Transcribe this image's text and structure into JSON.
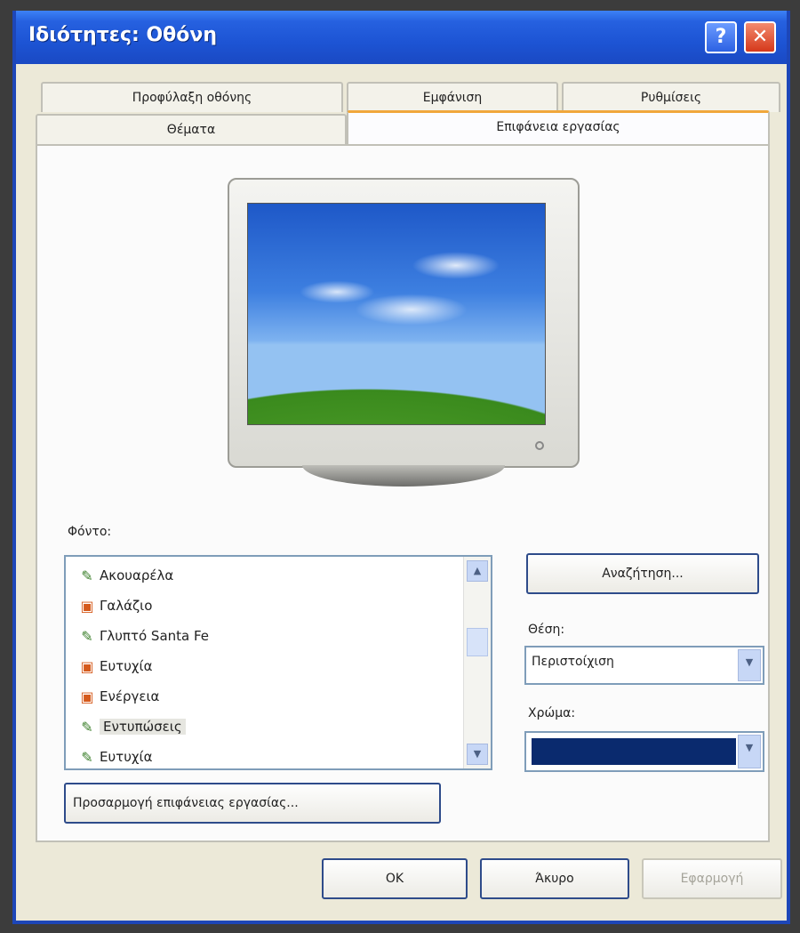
{
  "window": {
    "title": "Ιδιότητες: Οθόνη",
    "help_label": "?",
    "close_label": "✕"
  },
  "tabs": [
    {
      "label": "Προφύλαξη οθόνης"
    },
    {
      "label": "Εμφάνιση"
    },
    {
      "label": "Ρυθμίσεις"
    },
    {
      "label": "Θέματα"
    },
    {
      "label": "Επιφάνεια εργασίας",
      "active": true
    }
  ],
  "preview": {
    "image": "bliss-wallpaper"
  },
  "background_section": {
    "label": "Φόντο:",
    "items": [
      {
        "label": "Ακουαρέλα",
        "icon": "wallpaper-file-icon"
      },
      {
        "label": "Γαλάζιο",
        "icon": "bitmap-file-icon"
      },
      {
        "label": "Γλυπτό Santa Fe",
        "icon": "wallpaper-file-icon"
      },
      {
        "label": "Ευτυχία",
        "icon": "bitmap-file-icon"
      },
      {
        "label": "Ενέργεια",
        "icon": "bitmap-file-icon"
      },
      {
        "label": "Εντυπώσεις",
        "icon": "wallpaper-file-icon",
        "selected": true
      },
      {
        "label": "Ευτυχία",
        "icon": "wallpaper-file-icon"
      }
    ]
  },
  "browse_button": "Αναζήτηση...",
  "position": {
    "label": "Θέση:",
    "value": "Περιστοίχιση"
  },
  "color": {
    "label": "Χρώμα:",
    "value_hex": "#0a2a6e"
  },
  "customize_button": "Προσαρμογή επιφάνειας εργασίας...",
  "footer": {
    "ok": "OK",
    "cancel": "Άκυρο",
    "apply": "Εφαρμογή"
  }
}
